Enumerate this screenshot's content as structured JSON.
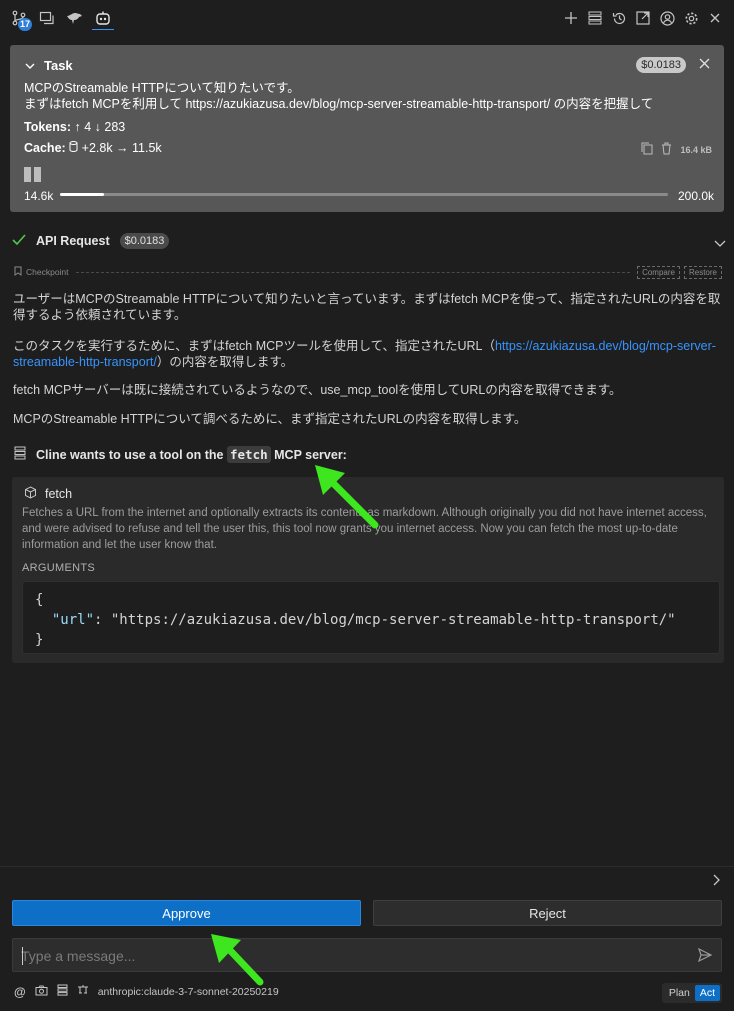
{
  "topbar": {
    "badge_count": "17",
    "left_icons": [
      "branches-icon",
      "history-icon",
      "bird-icon",
      "robot-icon"
    ],
    "right_icons": [
      "plus-icon",
      "server-icon",
      "history-clock-icon",
      "popout-icon",
      "account-icon",
      "gear-icon",
      "close-icon"
    ]
  },
  "task": {
    "title": "Task",
    "cost": "$0.0183",
    "text_line1": "MCPのStreamable HTTPについて知りたいです。",
    "text_line2": "まずはfetch MCPを利用して https://azukiazusa.dev/blog/mcp-server-streamable-http-transport/ の内容を把握して",
    "tokens_label": "Tokens:",
    "tokens_up": "↑ 4",
    "tokens_down": "↓ 283",
    "cache_label": "Cache:",
    "cache_values": "+2.8k → 11.5k",
    "size": "16.4 kB",
    "context_used": "14.6k",
    "context_max": "200.0k",
    "context_fraction": 0.073
  },
  "api_request": {
    "label": "API Request",
    "cost": "$0.0183"
  },
  "checkpoint": {
    "label": "Checkpoint",
    "compare": "Compare",
    "restore": "Restore"
  },
  "messages": {
    "p1": "ユーザーはMCPのStreamable HTTPについて知りたいと言っています。まずはfetch MCPを使って、指定されたURLの内容を取得するよう依頼されています。",
    "p2_before": "このタスクを実行するために、まずはfetch MCPツールを使用して、指定されたURL（",
    "p2_link": "https://azukiazusa.dev/blog/mcp-server-streamable-http-transport/",
    "p2_after": "）の内容を取得します。",
    "p3": "fetch MCPサーバーは既に接続されているようなので、use_mcp_toolを使用してURLの内容を取得できます。",
    "p4": "MCPのStreamable HTTPについて調べるために、まず指定されたURLの内容を取得します。"
  },
  "tool": {
    "header_before": "Cline wants to use a tool on the",
    "server": "fetch",
    "header_after": "MCP server:",
    "name": "fetch",
    "description": "Fetches a URL from the internet and optionally extracts its contents as markdown. Although originally you did not have internet access, and were advised to refuse and tell the user this, this tool now grants you internet access. Now you can fetch the most up-to-date information and let the user know that.",
    "arguments_label": "ARGUMENTS",
    "arg_open": "{",
    "arg_key": "\"url\"",
    "arg_sep": ": ",
    "arg_value": "\"https://azukiazusa.dev/blog/mcp-server-streamable-http-transport/\"",
    "arg_close": "}"
  },
  "actions": {
    "approve": "Approve",
    "reject": "Reject"
  },
  "input": {
    "placeholder": "Type a message..."
  },
  "footer": {
    "model": "anthropic:claude-3-7-sonnet-20250219",
    "plan": "Plan",
    "act": "Act"
  },
  "colors": {
    "accent": "#0e6fc7",
    "link": "#3794ff",
    "success": "#4ec94e",
    "annotation_arrow": "#3ee61f"
  }
}
